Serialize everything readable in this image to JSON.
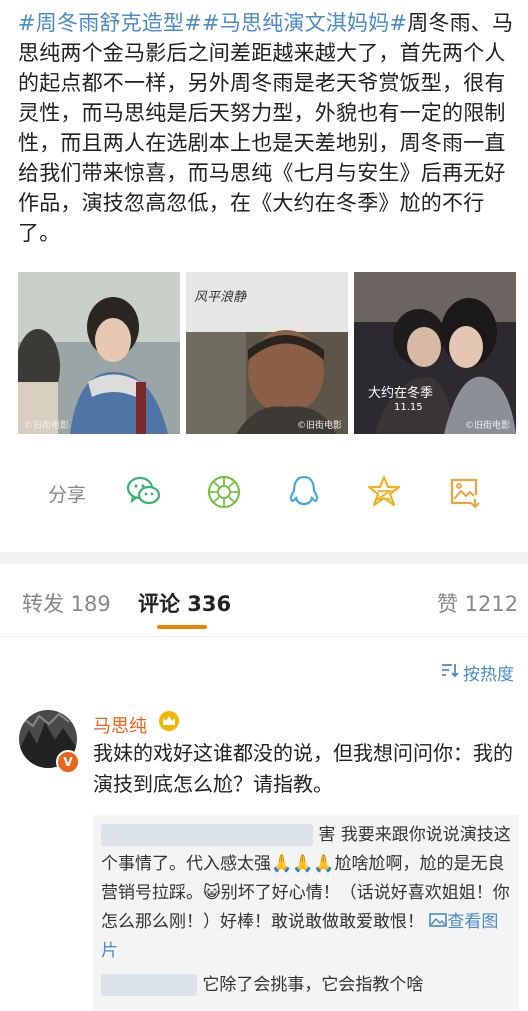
{
  "post": {
    "tag1": "#周冬雨舒克造型#",
    "tag2": "#马思纯演文淇妈妈#",
    "text": "周冬雨、马思纯两个金马影后之间差距越来越大了，首先两个人的起点都不一样，另外周冬雨是老天爷赏饭型，很有灵性，而马思纯是后天努力型，外貌也有一定的限制性，而且两人在选剧本上也是天差地别，周冬雨一直给我们带来惊喜，而马思纯《七月与安生》后再无好作品，演技忽高忽低，在《大约在冬季》尬的不行了。",
    "photos": [
      {
        "watermark": "©旧街电影"
      },
      {
        "title_text": "风平浪静",
        "watermark": "©旧街电影"
      },
      {
        "title_text": "大约在冬季",
        "date_text": "11.15",
        "watermark": "©旧街电影"
      }
    ]
  },
  "share": {
    "label": "分享",
    "icons": [
      "wechat-icon",
      "moments-icon",
      "qq-icon",
      "qzone-icon",
      "save-image-icon"
    ]
  },
  "tabs": {
    "forward": "转发 189",
    "comments": "评论 336",
    "likes": "赞 1212"
  },
  "sort": {
    "label": "按热度"
  },
  "comment": {
    "user": "马思纯",
    "badge": "V",
    "text": "我妹的戏好这谁都没的说，但我想问问你：我的演技到底怎么尬？请指教。",
    "replies": [
      {
        "text": "害 我要来跟你说说演技这个事情了。代入感太强🙏🙏🙏尬啥尬啊，尬的是无良营销号拉踩。😺别坏了好心情！（话说好喜欢姐姐！你怎么那么刚！）好棒！敢说敢做敢爱敢恨！",
        "link": "查看图片"
      },
      {
        "text": "它除了会挑事，它会指教个啥"
      }
    ]
  },
  "colors": {
    "link": "#4a8bc9",
    "accent": "#f08200",
    "username": "#e8641b"
  }
}
